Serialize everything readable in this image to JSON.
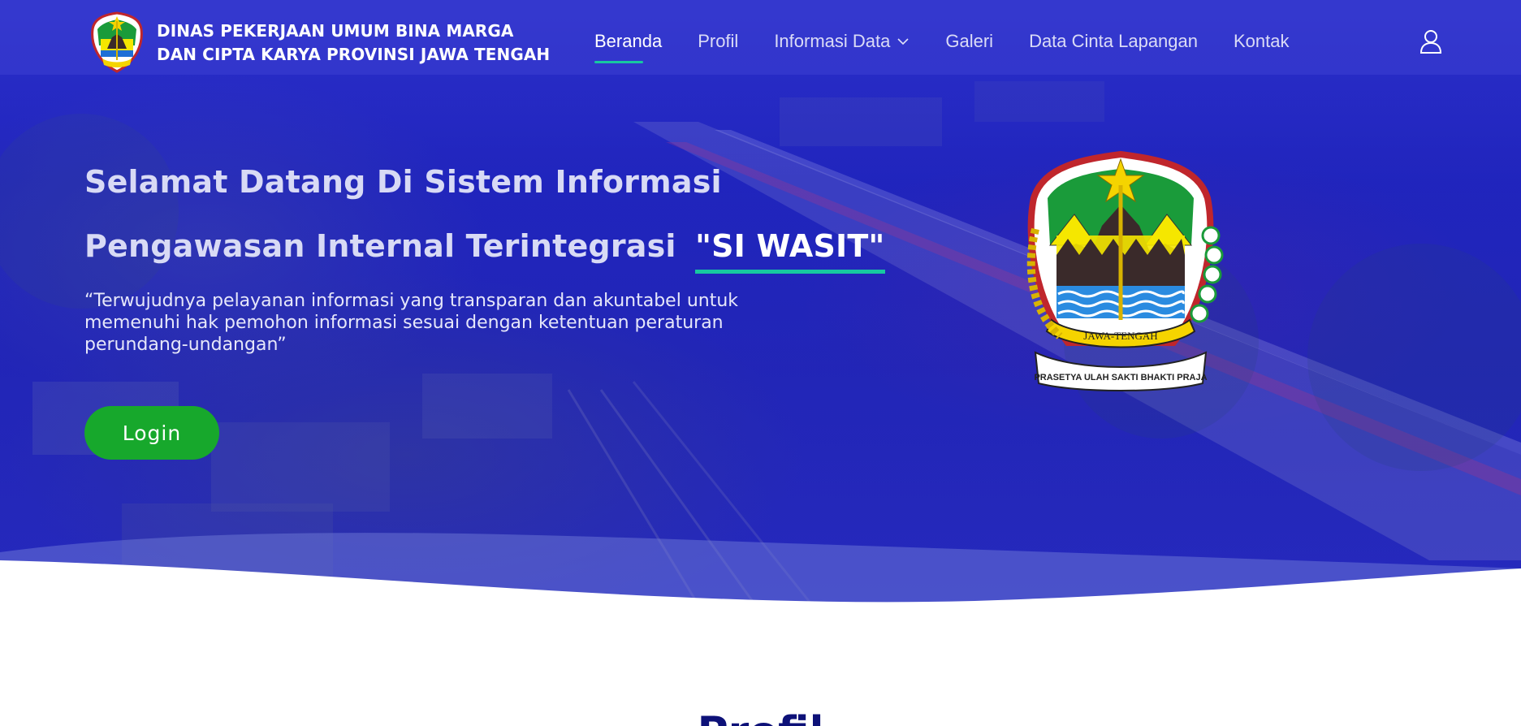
{
  "header": {
    "brand_line1": "DINAS PEKERJAAN UMUM BINA MARGA",
    "brand_line2": "DAN CIPTA KARYA PROVINSI JAWA TENGAH",
    "nav": [
      {
        "label": "Beranda",
        "active": true
      },
      {
        "label": "Profil"
      },
      {
        "label": "Informasi Data",
        "has_dropdown": true
      },
      {
        "label": "Galeri"
      },
      {
        "label": "Data Cinta Lapangan"
      },
      {
        "label": "Kontak"
      }
    ],
    "user_icon": "user-icon"
  },
  "hero": {
    "headline_line1": "Selamat Datang Di Sistem Informasi",
    "headline_line2": "Pengawasan Internal Terintegrasi",
    "headline_brand": "\"SI WASIT\"",
    "tagline": "“Terwujudnya pelayanan informasi yang transparan dan akuntabel untuk memenuhi hak pemohon informasi sesuai dengan ketentuan peraturan perundang-undangan”",
    "login_label": "Login",
    "emblem_banner": "JAWA-TENGAH",
    "emblem_motto": "PRASETYA ULAH SAKTI BHAKTI PRAJA"
  },
  "sections": {
    "profile_title": "Profil"
  },
  "colors": {
    "hero_blue": "#2a2ec8",
    "accent_teal": "#17c8a0",
    "login_green": "#17a82c",
    "title_navy": "#0d1178"
  }
}
